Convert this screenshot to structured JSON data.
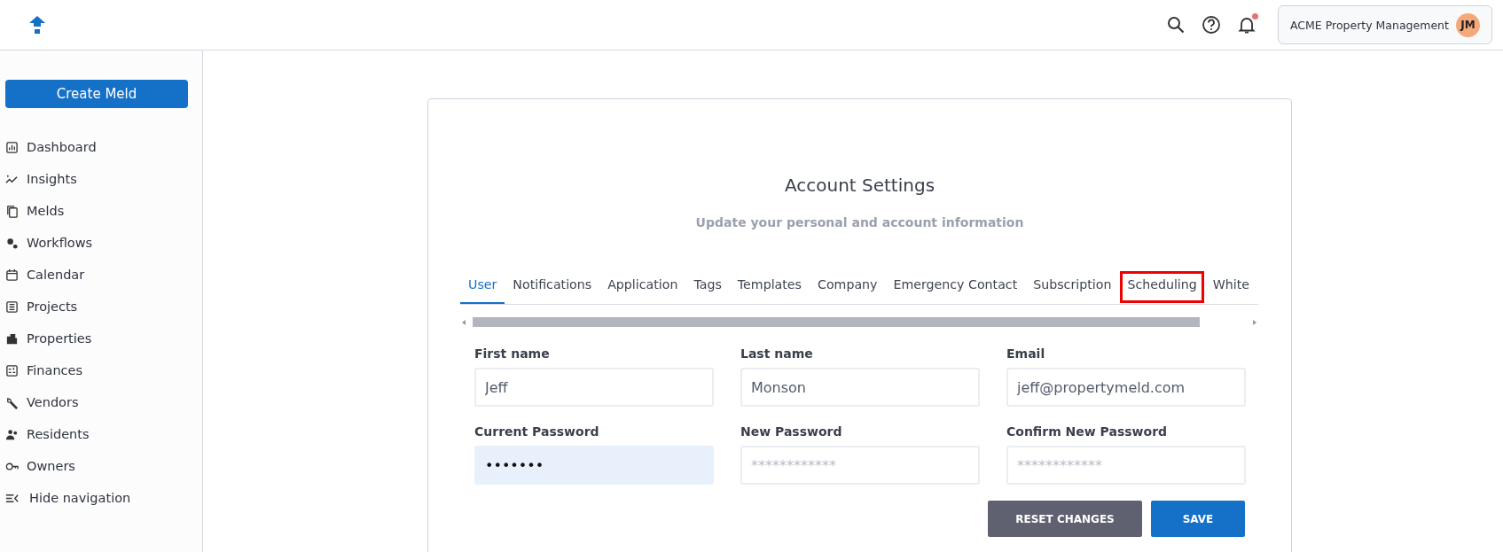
{
  "header": {
    "account_name": "ACME Property Management",
    "avatar_initials": "JM",
    "notifications_unread": true
  },
  "sidebar": {
    "create_button": "Create Meld",
    "items": [
      {
        "label": "Dashboard"
      },
      {
        "label": "Insights"
      },
      {
        "label": "Melds"
      },
      {
        "label": "Workflows"
      },
      {
        "label": "Calendar"
      },
      {
        "label": "Projects"
      },
      {
        "label": "Properties"
      },
      {
        "label": "Finances"
      },
      {
        "label": "Vendors"
      },
      {
        "label": "Residents"
      },
      {
        "label": "Owners"
      }
    ],
    "hide_navigation": "Hide navigation"
  },
  "card": {
    "title": "Account Settings",
    "subtitle": "Update your personal and account information",
    "tabs": [
      {
        "label": "User",
        "selected": true,
        "highlighted": false
      },
      {
        "label": "Notifications",
        "selected": false,
        "highlighted": false
      },
      {
        "label": "Application",
        "selected": false,
        "highlighted": false
      },
      {
        "label": "Tags",
        "selected": false,
        "highlighted": false
      },
      {
        "label": "Templates",
        "selected": false,
        "highlighted": false
      },
      {
        "label": "Company",
        "selected": false,
        "highlighted": false
      },
      {
        "label": "Emergency Contact",
        "selected": false,
        "highlighted": false
      },
      {
        "label": "Subscription",
        "selected": false,
        "highlighted": false
      },
      {
        "label": "Scheduling",
        "selected": false,
        "highlighted": true
      },
      {
        "label": "White",
        "selected": false,
        "highlighted": false
      }
    ],
    "fields": [
      {
        "label": "First name",
        "value": "Jeff",
        "autofilled": false
      },
      {
        "label": "Last name",
        "value": "Monson",
        "autofilled": false
      },
      {
        "label": "Email",
        "value": "jeff@propertymeld.com",
        "autofilled": false
      },
      {
        "label": "Current Password",
        "value": "•••••••",
        "autofilled": true
      },
      {
        "label": "New Password",
        "placeholder": "************",
        "autofilled": false
      },
      {
        "label": "Confirm New Password",
        "placeholder": "************",
        "autofilled": false
      }
    ],
    "buttons": [
      {
        "label": "RESET CHANGES",
        "kind": "secondary"
      },
      {
        "label": "SAVE",
        "kind": "primary"
      }
    ]
  }
}
